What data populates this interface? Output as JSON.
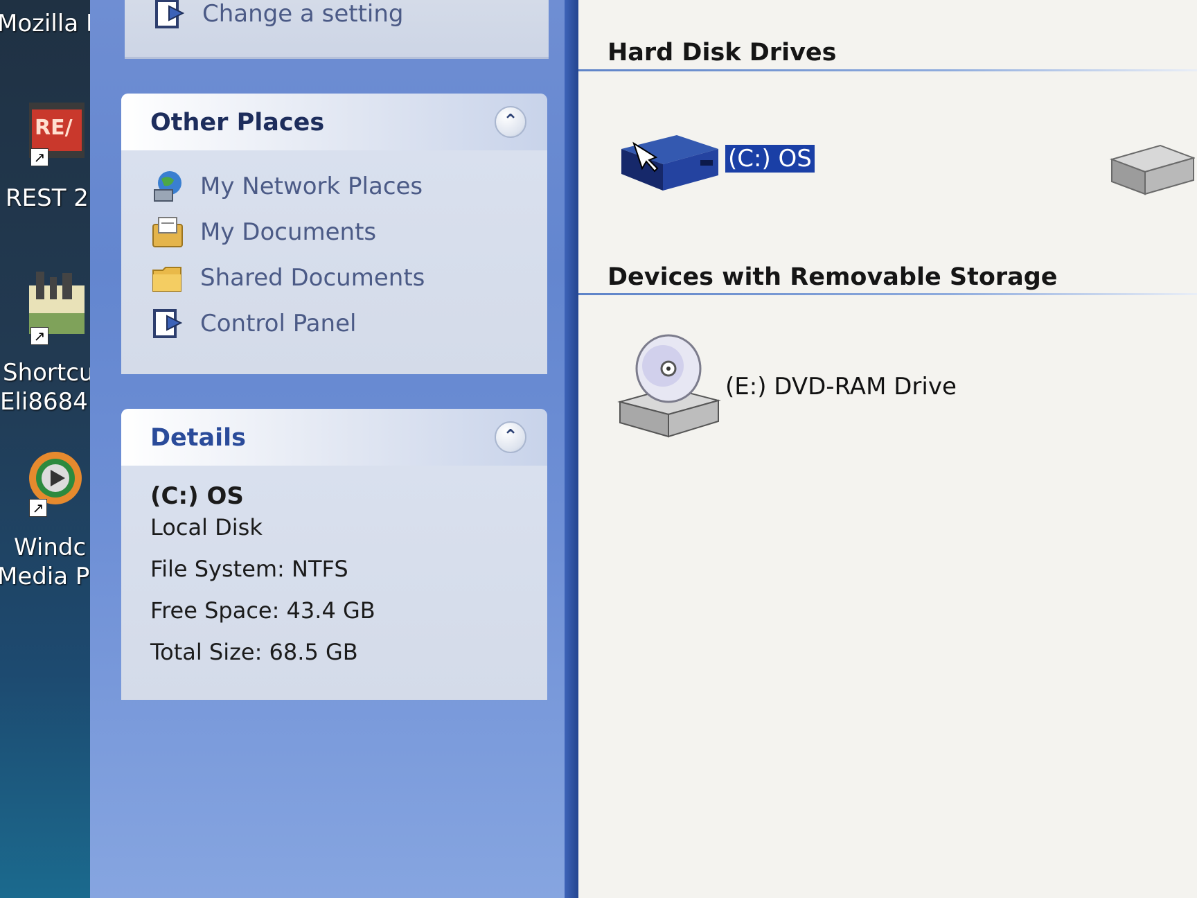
{
  "desktop": {
    "items": [
      {
        "label": "Mozilla Fi"
      },
      {
        "label": "REST 2"
      },
      {
        "label_line1": "Shortcu",
        "label_line2": "Eli8684"
      },
      {
        "label_line1": "Windc",
        "label_line2": "Media P"
      }
    ]
  },
  "tasks": {
    "change_setting": "Change a setting"
  },
  "other_places": {
    "title": "Other Places",
    "links": [
      {
        "label": "My Network Places",
        "icon": "network-icon"
      },
      {
        "label": "My Documents",
        "icon": "documents-icon"
      },
      {
        "label": "Shared Documents",
        "icon": "folder-icon"
      },
      {
        "label": "Control Panel",
        "icon": "control-panel-icon"
      }
    ]
  },
  "details": {
    "title": "Details",
    "name": "(C:) OS",
    "type": "Local Disk",
    "file_system": "File System: NTFS",
    "free_space": "Free Space: 43.4 GB",
    "total_size": "Total Size: 68.5 GB"
  },
  "content": {
    "groups": [
      {
        "title": "Hard Disk Drives",
        "items": [
          {
            "label": "(C:) OS",
            "selected": true,
            "icon": "hard-drive-icon"
          }
        ]
      },
      {
        "title": "Devices with Removable Storage",
        "items": [
          {
            "label": "(E:) DVD-RAM Drive",
            "icon": "dvd-drive-icon"
          }
        ]
      }
    ]
  },
  "colors": {
    "taskpane": "#6386cf",
    "selection": "#1a3fa6",
    "panel_title": "#1d2d5c"
  }
}
